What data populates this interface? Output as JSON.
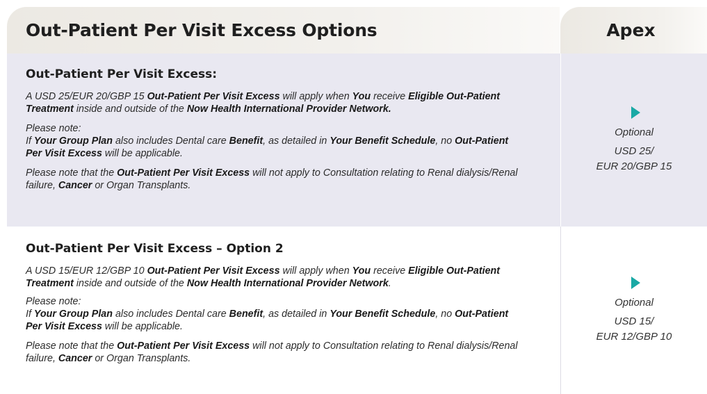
{
  "header": {
    "title": "Out-Patient Per Visit Excess Options",
    "plan": "Apex"
  },
  "sections": [
    {
      "title": "Out-Patient Per Visit Excess:",
      "p1": [
        "A USD 25/EUR 20/GBP 15 ",
        "Out-Patient Per Visit Excess",
        " will apply when ",
        "You",
        " receive ",
        "Eligible Out-Patient Treatment",
        " inside and outside of the ",
        "Now Health International Provider Network."
      ],
      "note_label": "Please note:",
      "p2": [
        "If ",
        "Your Group Plan",
        " also includes Dental care ",
        "Benefit",
        ", as detailed in ",
        "Your Benefit Schedule",
        ", no ",
        "Out-Patient Per Visit Excess",
        " will be applicable."
      ],
      "p3": [
        "Please note that the ",
        "Out-Patient Per Visit Excess",
        " will not apply to Consultation relating to Renal dialysis/Renal failure, ",
        "Cancer",
        " or Organ Transplants."
      ],
      "cell": {
        "status": "Optional",
        "amount_line1": "USD 25/",
        "amount_line2": "EUR 20/GBP 15"
      }
    },
    {
      "title": "Out-Patient Per Visit Excess – Option 2",
      "p1": [
        "A USD 15/EUR 12/GBP 10 ",
        "Out-Patient Per Visit Excess",
        " will apply when ",
        "You",
        " receive ",
        "Eligible Out-Patient Treatment",
        " inside and outside of the ",
        "Now Health International Provider Network",
        "."
      ],
      "note_label": "Please note:",
      "p2": [
        "If ",
        "Your Group Plan",
        " also includes Dental care ",
        "Benefit",
        ", as detailed in ",
        "Your Benefit Schedule",
        ", no ",
        "Out-Patient Per Visit Excess",
        " will be applicable."
      ],
      "p3": [
        "Please note that the ",
        "Out-Patient Per Visit Excess",
        " will not apply to Consultation relating to Renal dialysis/Renal failure, ",
        "Cancer",
        " or Organ Transplants."
      ],
      "cell": {
        "status": "Optional",
        "amount_line1": "USD 15/",
        "amount_line2": "EUR 12/GBP 10"
      }
    }
  ],
  "colors": {
    "header_bg": "#ece9e3",
    "row_shaded": "#e9e8f1",
    "accent_arrow": "#1aa9a5"
  },
  "icons": {
    "arrow": "play-arrow-icon"
  }
}
